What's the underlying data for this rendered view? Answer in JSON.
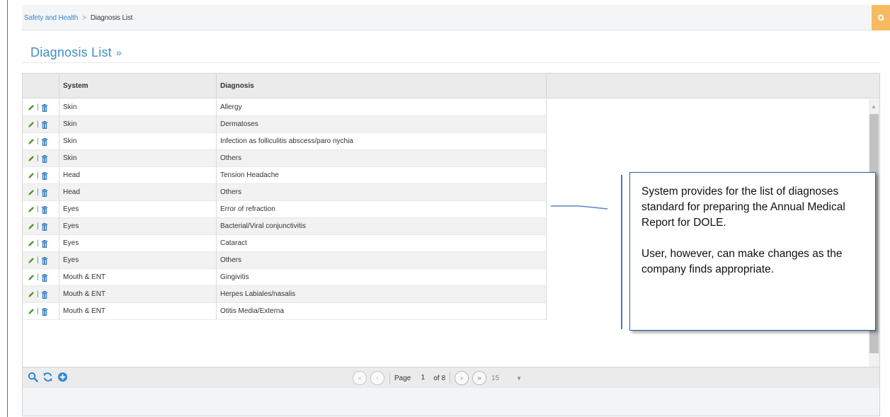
{
  "breadcrumb": {
    "parent": "Safety and Health",
    "separator": ">",
    "current": "Diagnosis List"
  },
  "page": {
    "title": "Diagnosis List",
    "title_suffix": "»"
  },
  "grid": {
    "columns": [
      "System",
      "Diagnosis"
    ],
    "rows": [
      {
        "system": "Skin",
        "diagnosis": "Allergy"
      },
      {
        "system": "Skin",
        "diagnosis": "Dermatoses"
      },
      {
        "system": "Skin",
        "diagnosis": "Infection as folliculitis abscess/paro nychia"
      },
      {
        "system": "Skin",
        "diagnosis": "Others"
      },
      {
        "system": "Head",
        "diagnosis": "Tension Headache"
      },
      {
        "system": "Head",
        "diagnosis": "Others"
      },
      {
        "system": "Eyes",
        "diagnosis": "Error of refraction"
      },
      {
        "system": "Eyes",
        "diagnosis": "Bacterial/Viral conjunctivitis"
      },
      {
        "system": "Eyes",
        "diagnosis": "Cataract"
      },
      {
        "system": "Eyes",
        "diagnosis": "Others"
      },
      {
        "system": "Mouth & ENT",
        "diagnosis": "Gingivitis"
      },
      {
        "system": "Mouth & ENT",
        "diagnosis": "Herpes Labiales/nasalis"
      },
      {
        "system": "Mouth & ENT",
        "diagnosis": "Otitis Media/Externa"
      }
    ],
    "action_separator": "|"
  },
  "pager": {
    "page_label": "Page",
    "current_page": "1",
    "of_label": "of 8",
    "page_size": "15"
  },
  "callout": {
    "paragraph1": "System provides for the list of diagnoses standard for preparing the Annual Medical Report for DOLE.",
    "paragraph2": "User, however, can make changes as the company finds appropriate."
  },
  "icons": {
    "gear": "gear-icon",
    "edit": "pencil-icon",
    "delete": "trash-icon",
    "search": "search-icon",
    "refresh": "refresh-icon",
    "add": "add-circle-icon"
  },
  "colors": {
    "accent_blue": "#3f8fc5",
    "gear_orange": "#f6ba60",
    "edit_green": "#4a9a2e",
    "delete_blue": "#3a7ec2",
    "callout_border": "#2e5f9a"
  }
}
